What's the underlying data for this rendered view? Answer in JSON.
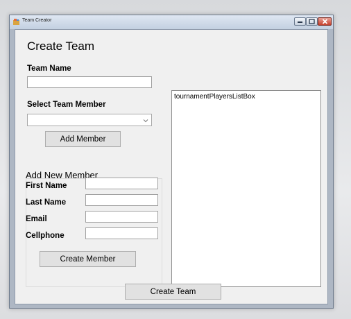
{
  "window": {
    "title": "Team Creator",
    "controls": {
      "minimize": "–",
      "maximize": "□",
      "close": "✕"
    }
  },
  "form": {
    "heading": "Create Team",
    "team_name": {
      "label": "Team Name",
      "value": ""
    },
    "select_member": {
      "label": "Select Team Member",
      "selected": ""
    },
    "add_member_button": "Add Member",
    "new_member_group": {
      "caption": "Add New Member",
      "fields": [
        {
          "label": "First Name",
          "value": ""
        },
        {
          "label": "Last Name",
          "value": ""
        },
        {
          "label": "Email",
          "value": ""
        },
        {
          "label": "Cellphone",
          "value": ""
        }
      ],
      "create_member_button": "Create Member"
    },
    "players_listbox": {
      "items": [
        "tournamentPlayersListBox"
      ]
    },
    "create_team_button": "Create Team"
  },
  "colors": {
    "client_bg": "#f0f0f0",
    "button_bg": "#e1e1e1",
    "frame": "#aeb7c4",
    "close_button": "#c7402c"
  },
  "icons": {
    "app": "app-icon",
    "combo_arrow": "chevron-down-icon"
  }
}
